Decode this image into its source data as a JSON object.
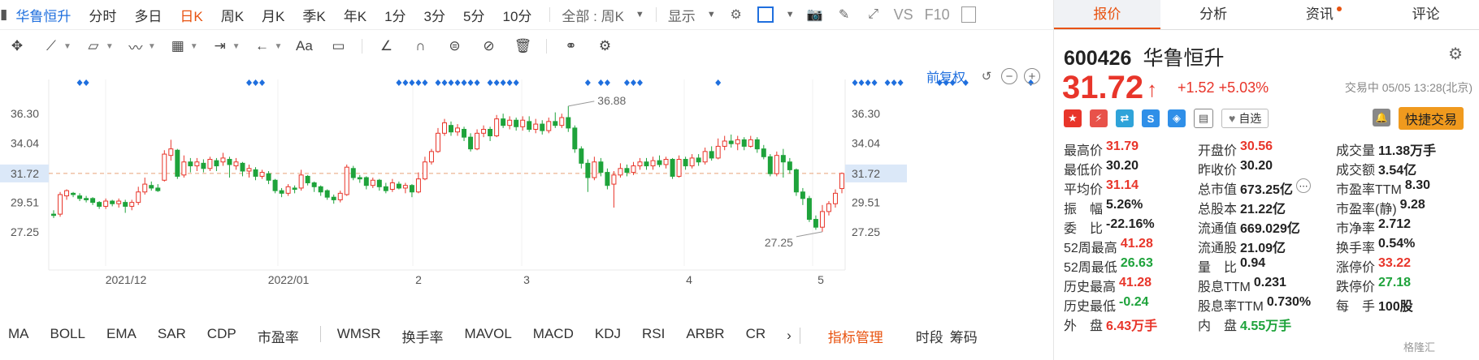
{
  "top": {
    "stock_name": "华鲁恒升",
    "tabs": [
      "分时",
      "多日",
      "日K",
      "周K",
      "月K",
      "季K",
      "年K",
      "1分",
      "3分",
      "5分",
      "10分"
    ],
    "active_tab": "日K",
    "period_select": "全部 : 周K",
    "display_label": "显示",
    "vs_label": "VS",
    "f10_label": "F10"
  },
  "chart": {
    "fq_label": "前复权",
    "y_ticks": [
      "36.30",
      "34.04",
      "31.72",
      "29.51",
      "27.25"
    ],
    "x_labels": [
      "2021/12",
      "2022/01",
      "2",
      "3",
      "4",
      "5"
    ],
    "current_price_label": "31.72",
    "high_label": "36.88",
    "low_label": "27.25",
    "up_color": "#e8352a",
    "down_color": "#1ea33b",
    "marker_color": "#1f6fde"
  },
  "chart_data": {
    "type": "candlestick",
    "ylim": [
      25.5,
      38.3
    ],
    "y_ticks": [
      36.3,
      34.04,
      31.72,
      29.51,
      27.25
    ],
    "current_price": 31.72,
    "highest": 36.88,
    "lowest": 27.25,
    "candles": [
      {
        "o": 28.6,
        "c": 28.5,
        "h": 28.9,
        "l": 28.3
      },
      {
        "o": 28.6,
        "c": 30.1,
        "h": 30.3,
        "l": 28.4
      },
      {
        "o": 30.0,
        "c": 30.4,
        "h": 30.5,
        "l": 29.7
      },
      {
        "o": 30.2,
        "c": 30.1,
        "h": 30.3,
        "l": 29.9
      },
      {
        "o": 30.0,
        "c": 29.8,
        "h": 30.2,
        "l": 29.6
      },
      {
        "o": 29.8,
        "c": 29.7,
        "h": 30.0,
        "l": 29.5
      },
      {
        "o": 29.8,
        "c": 29.5,
        "h": 29.9,
        "l": 29.3
      },
      {
        "o": 29.5,
        "c": 29.2,
        "h": 29.6,
        "l": 29.0
      },
      {
        "o": 29.2,
        "c": 29.6,
        "h": 29.8,
        "l": 29.0
      },
      {
        "o": 29.6,
        "c": 29.4,
        "h": 29.7,
        "l": 29.2
      },
      {
        "o": 29.4,
        "c": 29.6,
        "h": 29.8,
        "l": 29.1
      },
      {
        "o": 29.5,
        "c": 29.2,
        "h": 29.7,
        "l": 28.7
      },
      {
        "o": 29.2,
        "c": 29.5,
        "h": 29.7,
        "l": 28.9
      },
      {
        "o": 29.5,
        "c": 30.3,
        "h": 30.7,
        "l": 29.3
      },
      {
        "o": 30.3,
        "c": 30.9,
        "h": 31.4,
        "l": 30.1
      },
      {
        "o": 30.8,
        "c": 30.6,
        "h": 31.1,
        "l": 30.4
      },
      {
        "o": 30.6,
        "c": 30.4,
        "h": 30.9,
        "l": 30.3
      },
      {
        "o": 31.2,
        "c": 33.2,
        "h": 33.5,
        "l": 31.1
      },
      {
        "o": 33.1,
        "c": 33.6,
        "h": 34.3,
        "l": 32.7
      },
      {
        "o": 33.5,
        "c": 31.5,
        "h": 33.6,
        "l": 31.3
      },
      {
        "o": 31.6,
        "c": 32.6,
        "h": 33.1,
        "l": 31.4
      },
      {
        "o": 32.6,
        "c": 32.3,
        "h": 32.9,
        "l": 31.8
      },
      {
        "o": 32.3,
        "c": 32.6,
        "h": 32.9,
        "l": 31.9
      },
      {
        "o": 32.5,
        "c": 32.1,
        "h": 32.8,
        "l": 31.8
      },
      {
        "o": 32.1,
        "c": 32.8,
        "h": 33.0,
        "l": 31.9
      },
      {
        "o": 32.7,
        "c": 32.3,
        "h": 32.9,
        "l": 31.9
      },
      {
        "o": 32.6,
        "c": 32.9,
        "h": 33.3,
        "l": 32.3
      },
      {
        "o": 32.8,
        "c": 32.4,
        "h": 33.0,
        "l": 31.4
      },
      {
        "o": 32.3,
        "c": 32.6,
        "h": 32.9,
        "l": 32.0
      },
      {
        "o": 32.5,
        "c": 31.9,
        "h": 32.6,
        "l": 31.5
      },
      {
        "o": 31.9,
        "c": 32.1,
        "h": 32.4,
        "l": 31.4
      },
      {
        "o": 32.0,
        "c": 31.5,
        "h": 32.2,
        "l": 31.2
      },
      {
        "o": 31.5,
        "c": 31.8,
        "h": 32.0,
        "l": 31.3
      },
      {
        "o": 31.7,
        "c": 31.2,
        "h": 31.9,
        "l": 30.9
      },
      {
        "o": 31.2,
        "c": 30.4,
        "h": 31.3,
        "l": 30.2
      },
      {
        "o": 30.4,
        "c": 30.2,
        "h": 30.6,
        "l": 29.9
      },
      {
        "o": 30.2,
        "c": 30.7,
        "h": 30.9,
        "l": 30.0
      },
      {
        "o": 30.6,
        "c": 30.5,
        "h": 30.8,
        "l": 30.2
      },
      {
        "o": 30.6,
        "c": 31.6,
        "h": 32.0,
        "l": 30.4
      },
      {
        "o": 31.5,
        "c": 31.0,
        "h": 31.6,
        "l": 30.8
      },
      {
        "o": 31.0,
        "c": 30.7,
        "h": 31.1,
        "l": 30.3
      },
      {
        "o": 30.7,
        "c": 30.3,
        "h": 30.8,
        "l": 30.0
      },
      {
        "o": 30.4,
        "c": 29.9,
        "h": 30.5,
        "l": 29.7
      },
      {
        "o": 29.9,
        "c": 29.7,
        "h": 30.1,
        "l": 29.4
      },
      {
        "o": 29.7,
        "c": 30.2,
        "h": 30.4,
        "l": 29.5
      },
      {
        "o": 30.1,
        "c": 32.2,
        "h": 32.4,
        "l": 30.0
      },
      {
        "o": 32.1,
        "c": 31.4,
        "h": 32.3,
        "l": 31.2
      },
      {
        "o": 31.4,
        "c": 31.3,
        "h": 31.6,
        "l": 31.0
      },
      {
        "o": 31.4,
        "c": 30.8,
        "h": 31.5,
        "l": 30.5
      },
      {
        "o": 30.8,
        "c": 31.2,
        "h": 31.4,
        "l": 30.6
      },
      {
        "o": 31.2,
        "c": 30.7,
        "h": 31.3,
        "l": 30.4
      },
      {
        "o": 30.7,
        "c": 30.4,
        "h": 31.0,
        "l": 30.2
      },
      {
        "o": 30.5,
        "c": 31.0,
        "h": 31.3,
        "l": 30.3
      },
      {
        "o": 30.9,
        "c": 30.6,
        "h": 31.1,
        "l": 30.5
      },
      {
        "o": 30.6,
        "c": 30.8,
        "h": 31.0,
        "l": 30.2
      },
      {
        "o": 30.8,
        "c": 30.3,
        "h": 30.9,
        "l": 29.9
      },
      {
        "o": 30.3,
        "c": 31.3,
        "h": 31.8,
        "l": 30.2
      },
      {
        "o": 31.3,
        "c": 32.6,
        "h": 33.0,
        "l": 31.2
      },
      {
        "o": 32.6,
        "c": 33.4,
        "h": 33.6,
        "l": 32.4
      },
      {
        "o": 33.4,
        "c": 34.8,
        "h": 35.2,
        "l": 33.3
      },
      {
        "o": 34.8,
        "c": 35.6,
        "h": 35.9,
        "l": 34.6
      },
      {
        "o": 35.4,
        "c": 34.9,
        "h": 35.7,
        "l": 34.6
      },
      {
        "o": 34.9,
        "c": 35.2,
        "h": 35.5,
        "l": 34.6
      },
      {
        "o": 35.1,
        "c": 34.5,
        "h": 35.3,
        "l": 34.2
      },
      {
        "o": 34.5,
        "c": 33.6,
        "h": 34.8,
        "l": 33.4
      },
      {
        "o": 33.6,
        "c": 34.8,
        "h": 35.1,
        "l": 33.5
      },
      {
        "o": 34.8,
        "c": 35.1,
        "h": 35.4,
        "l": 34.5
      },
      {
        "o": 35.1,
        "c": 34.6,
        "h": 35.3,
        "l": 34.2
      },
      {
        "o": 34.6,
        "c": 35.9,
        "h": 36.2,
        "l": 34.5
      },
      {
        "o": 35.9,
        "c": 35.4,
        "h": 36.3,
        "l": 35.2
      },
      {
        "o": 35.4,
        "c": 35.8,
        "h": 36.1,
        "l": 35.1
      },
      {
        "o": 35.8,
        "c": 35.3,
        "h": 36.0,
        "l": 35.0
      },
      {
        "o": 35.3,
        "c": 35.8,
        "h": 36.1,
        "l": 35.0
      },
      {
        "o": 35.7,
        "c": 35.1,
        "h": 36.1,
        "l": 34.9
      },
      {
        "o": 35.1,
        "c": 35.5,
        "h": 35.9,
        "l": 34.8
      },
      {
        "o": 35.5,
        "c": 35.0,
        "h": 35.8,
        "l": 34.7
      },
      {
        "o": 35.0,
        "c": 35.7,
        "h": 36.0,
        "l": 34.8
      },
      {
        "o": 35.7,
        "c": 35.4,
        "h": 36.4,
        "l": 35.2
      },
      {
        "o": 35.4,
        "c": 36.0,
        "h": 36.3,
        "l": 35.2
      },
      {
        "o": 36.0,
        "c": 35.2,
        "h": 36.88,
        "l": 34.9
      },
      {
        "o": 35.2,
        "c": 33.6,
        "h": 35.4,
        "l": 33.3
      },
      {
        "o": 33.6,
        "c": 32.5,
        "h": 33.8,
        "l": 32.1
      },
      {
        "o": 32.5,
        "c": 31.4,
        "h": 32.8,
        "l": 30.3
      },
      {
        "o": 31.4,
        "c": 32.6,
        "h": 33.0,
        "l": 31.2
      },
      {
        "o": 32.6,
        "c": 31.8,
        "h": 32.9,
        "l": 31.5
      },
      {
        "o": 31.8,
        "c": 30.8,
        "h": 32.1,
        "l": 30.5
      },
      {
        "o": 30.9,
        "c": 31.6,
        "h": 31.9,
        "l": 29.1
      },
      {
        "o": 31.6,
        "c": 32.1,
        "h": 32.5,
        "l": 31.4
      },
      {
        "o": 32.1,
        "c": 31.8,
        "h": 32.4,
        "l": 31.5
      },
      {
        "o": 31.8,
        "c": 32.3,
        "h": 32.6,
        "l": 31.6
      },
      {
        "o": 32.3,
        "c": 32.6,
        "h": 32.9,
        "l": 32.0
      },
      {
        "o": 32.6,
        "c": 32.3,
        "h": 32.9,
        "l": 32.0
      },
      {
        "o": 32.3,
        "c": 32.7,
        "h": 33.0,
        "l": 32.0
      },
      {
        "o": 32.7,
        "c": 32.4,
        "h": 33.1,
        "l": 32.2
      },
      {
        "o": 32.4,
        "c": 32.8,
        "h": 33.0,
        "l": 32.1
      },
      {
        "o": 32.8,
        "c": 31.5,
        "h": 32.9,
        "l": 31.3
      },
      {
        "o": 31.5,
        "c": 32.8,
        "h": 33.1,
        "l": 31.4
      },
      {
        "o": 32.8,
        "c": 32.3,
        "h": 33.0,
        "l": 32.0
      },
      {
        "o": 32.3,
        "c": 32.9,
        "h": 33.2,
        "l": 32.1
      },
      {
        "o": 32.9,
        "c": 32.6,
        "h": 33.2,
        "l": 32.3
      },
      {
        "o": 32.6,
        "c": 33.4,
        "h": 33.7,
        "l": 32.4
      },
      {
        "o": 33.4,
        "c": 32.9,
        "h": 33.8,
        "l": 32.7
      },
      {
        "o": 32.9,
        "c": 33.8,
        "h": 34.4,
        "l": 32.8
      },
      {
        "o": 33.8,
        "c": 34.2,
        "h": 34.6,
        "l": 33.5
      },
      {
        "o": 34.2,
        "c": 34.0,
        "h": 34.7,
        "l": 33.7
      },
      {
        "o": 34.0,
        "c": 34.3,
        "h": 34.6,
        "l": 33.5
      },
      {
        "o": 34.3,
        "c": 33.8,
        "h": 34.5,
        "l": 33.5
      },
      {
        "o": 33.8,
        "c": 34.3,
        "h": 34.6,
        "l": 33.7
      },
      {
        "o": 34.3,
        "c": 33.6,
        "h": 34.5,
        "l": 33.3
      },
      {
        "o": 33.6,
        "c": 33.0,
        "h": 33.9,
        "l": 32.8
      },
      {
        "o": 33.0,
        "c": 31.7,
        "h": 33.2,
        "l": 31.5
      },
      {
        "o": 31.7,
        "c": 33.1,
        "h": 33.4,
        "l": 31.5
      },
      {
        "o": 33.1,
        "c": 32.6,
        "h": 33.6,
        "l": 31.4
      },
      {
        "o": 32.6,
        "c": 32.0,
        "h": 32.9,
        "l": 31.7
      },
      {
        "o": 32.0,
        "c": 30.3,
        "h": 32.1,
        "l": 30.0
      },
      {
        "o": 30.3,
        "c": 29.8,
        "h": 30.6,
        "l": 29.3
      },
      {
        "o": 29.8,
        "c": 28.2,
        "h": 30.0,
        "l": 28.0
      },
      {
        "o": 28.2,
        "c": 27.6,
        "h": 28.5,
        "l": 27.4
      },
      {
        "o": 27.6,
        "c": 28.8,
        "h": 29.3,
        "l": 27.25
      },
      {
        "o": 28.8,
        "c": 29.4,
        "h": 29.6,
        "l": 28.5
      },
      {
        "o": 29.4,
        "c": 30.2,
        "h": 30.5,
        "l": 29.1
      },
      {
        "o": 30.56,
        "c": 31.72,
        "h": 31.79,
        "l": 30.2
      }
    ],
    "markers": [
      4,
      5,
      30,
      31,
      32,
      53,
      54,
      55,
      56,
      57,
      59,
      60,
      61,
      62,
      63,
      64,
      65,
      67,
      68,
      69,
      70,
      71,
      82,
      84,
      85,
      88,
      89,
      90,
      102,
      123,
      124,
      125,
      126,
      128,
      129,
      130,
      136,
      137,
      138,
      140,
      150
    ]
  },
  "bottom": {
    "indicators": [
      "MA",
      "BOLL",
      "EMA",
      "SAR",
      "CDP",
      "市盈率",
      "WMSR",
      "换手率",
      "MAVOL",
      "MACD",
      "KDJ",
      "RSI",
      "ARBR",
      "CR"
    ],
    "manage_label": "指标管理",
    "right_labels": [
      "时段",
      "筹码"
    ]
  },
  "panel": {
    "tabs": [
      "报价",
      "分析",
      "资讯",
      "评论"
    ],
    "code": "600426",
    "name": "华鲁恒升",
    "price": "31.72",
    "change": "+1.52",
    "change_pct": "+5.03%",
    "status_time": "交易中 05/05 13:28(北京)",
    "watch_label": "自选",
    "quick_trade": "快捷交易",
    "rows": [
      [
        {
          "l": "最高价",
          "v": "31.79",
          "c": "red"
        },
        {
          "l": "开盘价",
          "v": "30.56",
          "c": "red"
        },
        {
          "l": "成交量",
          "v": "11.38万手",
          "c": "blk"
        }
      ],
      [
        {
          "l": "最低价",
          "v": "30.20",
          "c": "blk"
        },
        {
          "l": "昨收价",
          "v": "30.20",
          "c": "blk"
        },
        {
          "l": "成交额",
          "v": "3.54亿",
          "c": "blk"
        }
      ],
      [
        {
          "l": "平均价",
          "v": "31.14",
          "c": "red"
        },
        {
          "l": "总市值",
          "v": "673.25亿",
          "c": "blk"
        },
        {
          "l": "市盈率TTM",
          "v": "8.30",
          "c": "blk"
        }
      ],
      [
        {
          "l": "振　幅",
          "v": "5.26%",
          "c": "blk"
        },
        {
          "l": "总股本",
          "v": "21.22亿",
          "c": "blk"
        },
        {
          "l": "市盈率(静)",
          "v": "9.28",
          "c": "blk"
        }
      ],
      [
        {
          "l": "委　比",
          "v": "-22.16%",
          "c": "blk"
        },
        {
          "l": "流通值",
          "v": "669.029亿",
          "c": "blk"
        },
        {
          "l": "市净率",
          "v": "2.712",
          "c": "blk"
        }
      ],
      [
        {
          "l": "52周最高",
          "v": "41.28",
          "c": "red"
        },
        {
          "l": "流通股",
          "v": "21.09亿",
          "c": "blk"
        },
        {
          "l": "换手率",
          "v": "0.54%",
          "c": "blk"
        }
      ],
      [
        {
          "l": "52周最低",
          "v": "26.63",
          "c": "green"
        },
        {
          "l": "量　比",
          "v": "0.94",
          "c": "blk"
        },
        {
          "l": "涨停价",
          "v": "33.22",
          "c": "red"
        }
      ],
      [
        {
          "l": "历史最高",
          "v": "41.28",
          "c": "red"
        },
        {
          "l": "股息TTM",
          "v": "0.231",
          "c": "blk"
        },
        {
          "l": "跌停价",
          "v": "27.18",
          "c": "green"
        }
      ],
      [
        {
          "l": "历史最低",
          "v": "-0.24",
          "c": "green"
        },
        {
          "l": "股息率TTM",
          "v": "0.730%",
          "c": "blk"
        },
        {
          "l": "每　手",
          "v": "100股",
          "c": "blk"
        }
      ],
      [
        {
          "l": "外　盘",
          "v": "6.43万手",
          "c": "red"
        },
        {
          "l": "内　盘",
          "v": "4.55万手",
          "c": "green"
        }
      ]
    ],
    "watermark": "格隆汇"
  }
}
